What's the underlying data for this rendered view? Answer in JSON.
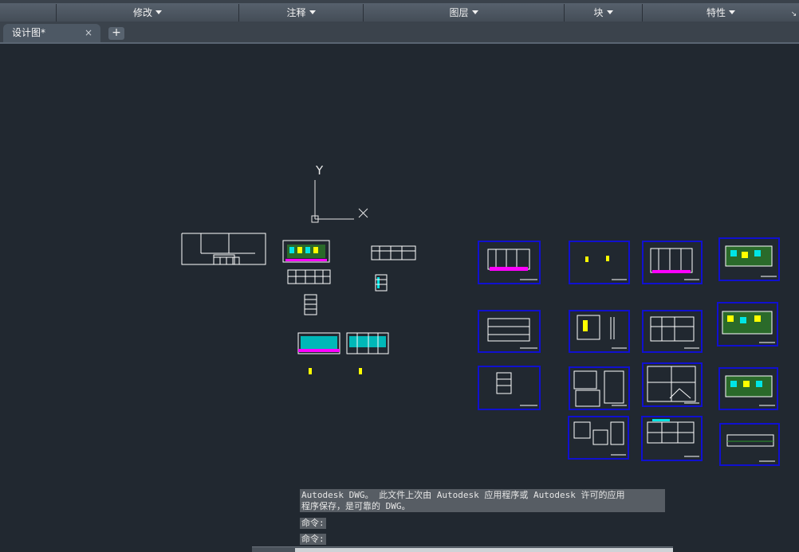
{
  "ribbon": {
    "panels": [
      {
        "label": "修改"
      },
      {
        "label": "注释"
      },
      {
        "label": "图层"
      },
      {
        "label": "块"
      },
      {
        "label": "特性"
      }
    ]
  },
  "tabs": {
    "active": "设计图*",
    "close_glyph": "×",
    "new_glyph": "+"
  },
  "ucs": {
    "x_label": "X",
    "y_label": "Y"
  },
  "command": {
    "history_line1": "Autodesk DWG。  此文件上次由 Autodesk 应用程序或 Autodesk 许可的应用",
    "history_line2": "程序保存，是可靠的 DWG。",
    "prompt1": "命令:",
    "prompt2": "命令:"
  },
  "colors": {
    "canvas_bg": "#212830",
    "frame_blue": "#1010d0",
    "linework": "#ffffff",
    "magenta": "#ff00ff",
    "cyan": "#00e5e5",
    "yellow": "#ffff00"
  }
}
